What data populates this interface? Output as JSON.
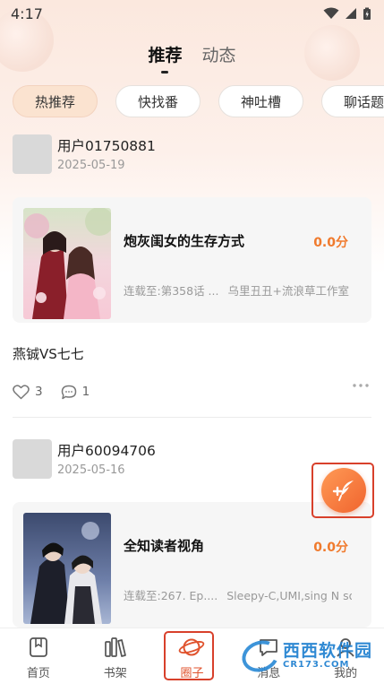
{
  "status_bar": {
    "time": "4:17"
  },
  "top_tabs": [
    {
      "label": "推荐",
      "active": true
    },
    {
      "label": "动态",
      "active": false
    }
  ],
  "chips": [
    {
      "label": "热推荐",
      "active": true
    },
    {
      "label": "快找番",
      "active": false
    },
    {
      "label": "神吐槽",
      "active": false
    },
    {
      "label": "聊话题",
      "active": false
    }
  ],
  "posts": [
    {
      "username": "用户01750881",
      "date": "2025-05-19",
      "comic": {
        "title": "炮灰闺女的生存方式",
        "score": "0.0分",
        "progress": "连载至:第358话 ...",
        "authors": "乌里丑丑+流浪草工作室"
      },
      "text": "燕铖VS七七",
      "likes": "3",
      "comments": "1"
    },
    {
      "username": "用户60094706",
      "date": "2025-05-16",
      "comic": {
        "title": "全知读者视角",
        "score": "0.0分",
        "progress": "连载至:267. Ep....",
        "authors": "Sleepy-C,UMI,sing N song"
      }
    }
  ],
  "bottom_nav": [
    {
      "label": "首页",
      "icon": "home-book-icon",
      "active": false
    },
    {
      "label": "书架",
      "icon": "bookshelf-icon",
      "active": false
    },
    {
      "label": "圈子",
      "icon": "planet-icon",
      "active": true
    },
    {
      "label": "消息",
      "icon": "message-icon",
      "active": false
    },
    {
      "label": "我的",
      "icon": "profile-icon",
      "active": false
    }
  ],
  "watermark": {
    "main": "西西软件园",
    "sub": "CR173.COM"
  },
  "colors": {
    "accent": "#f07a2d",
    "highlight_frame": "#d8402b",
    "chip_active": "#fbe3d0"
  }
}
